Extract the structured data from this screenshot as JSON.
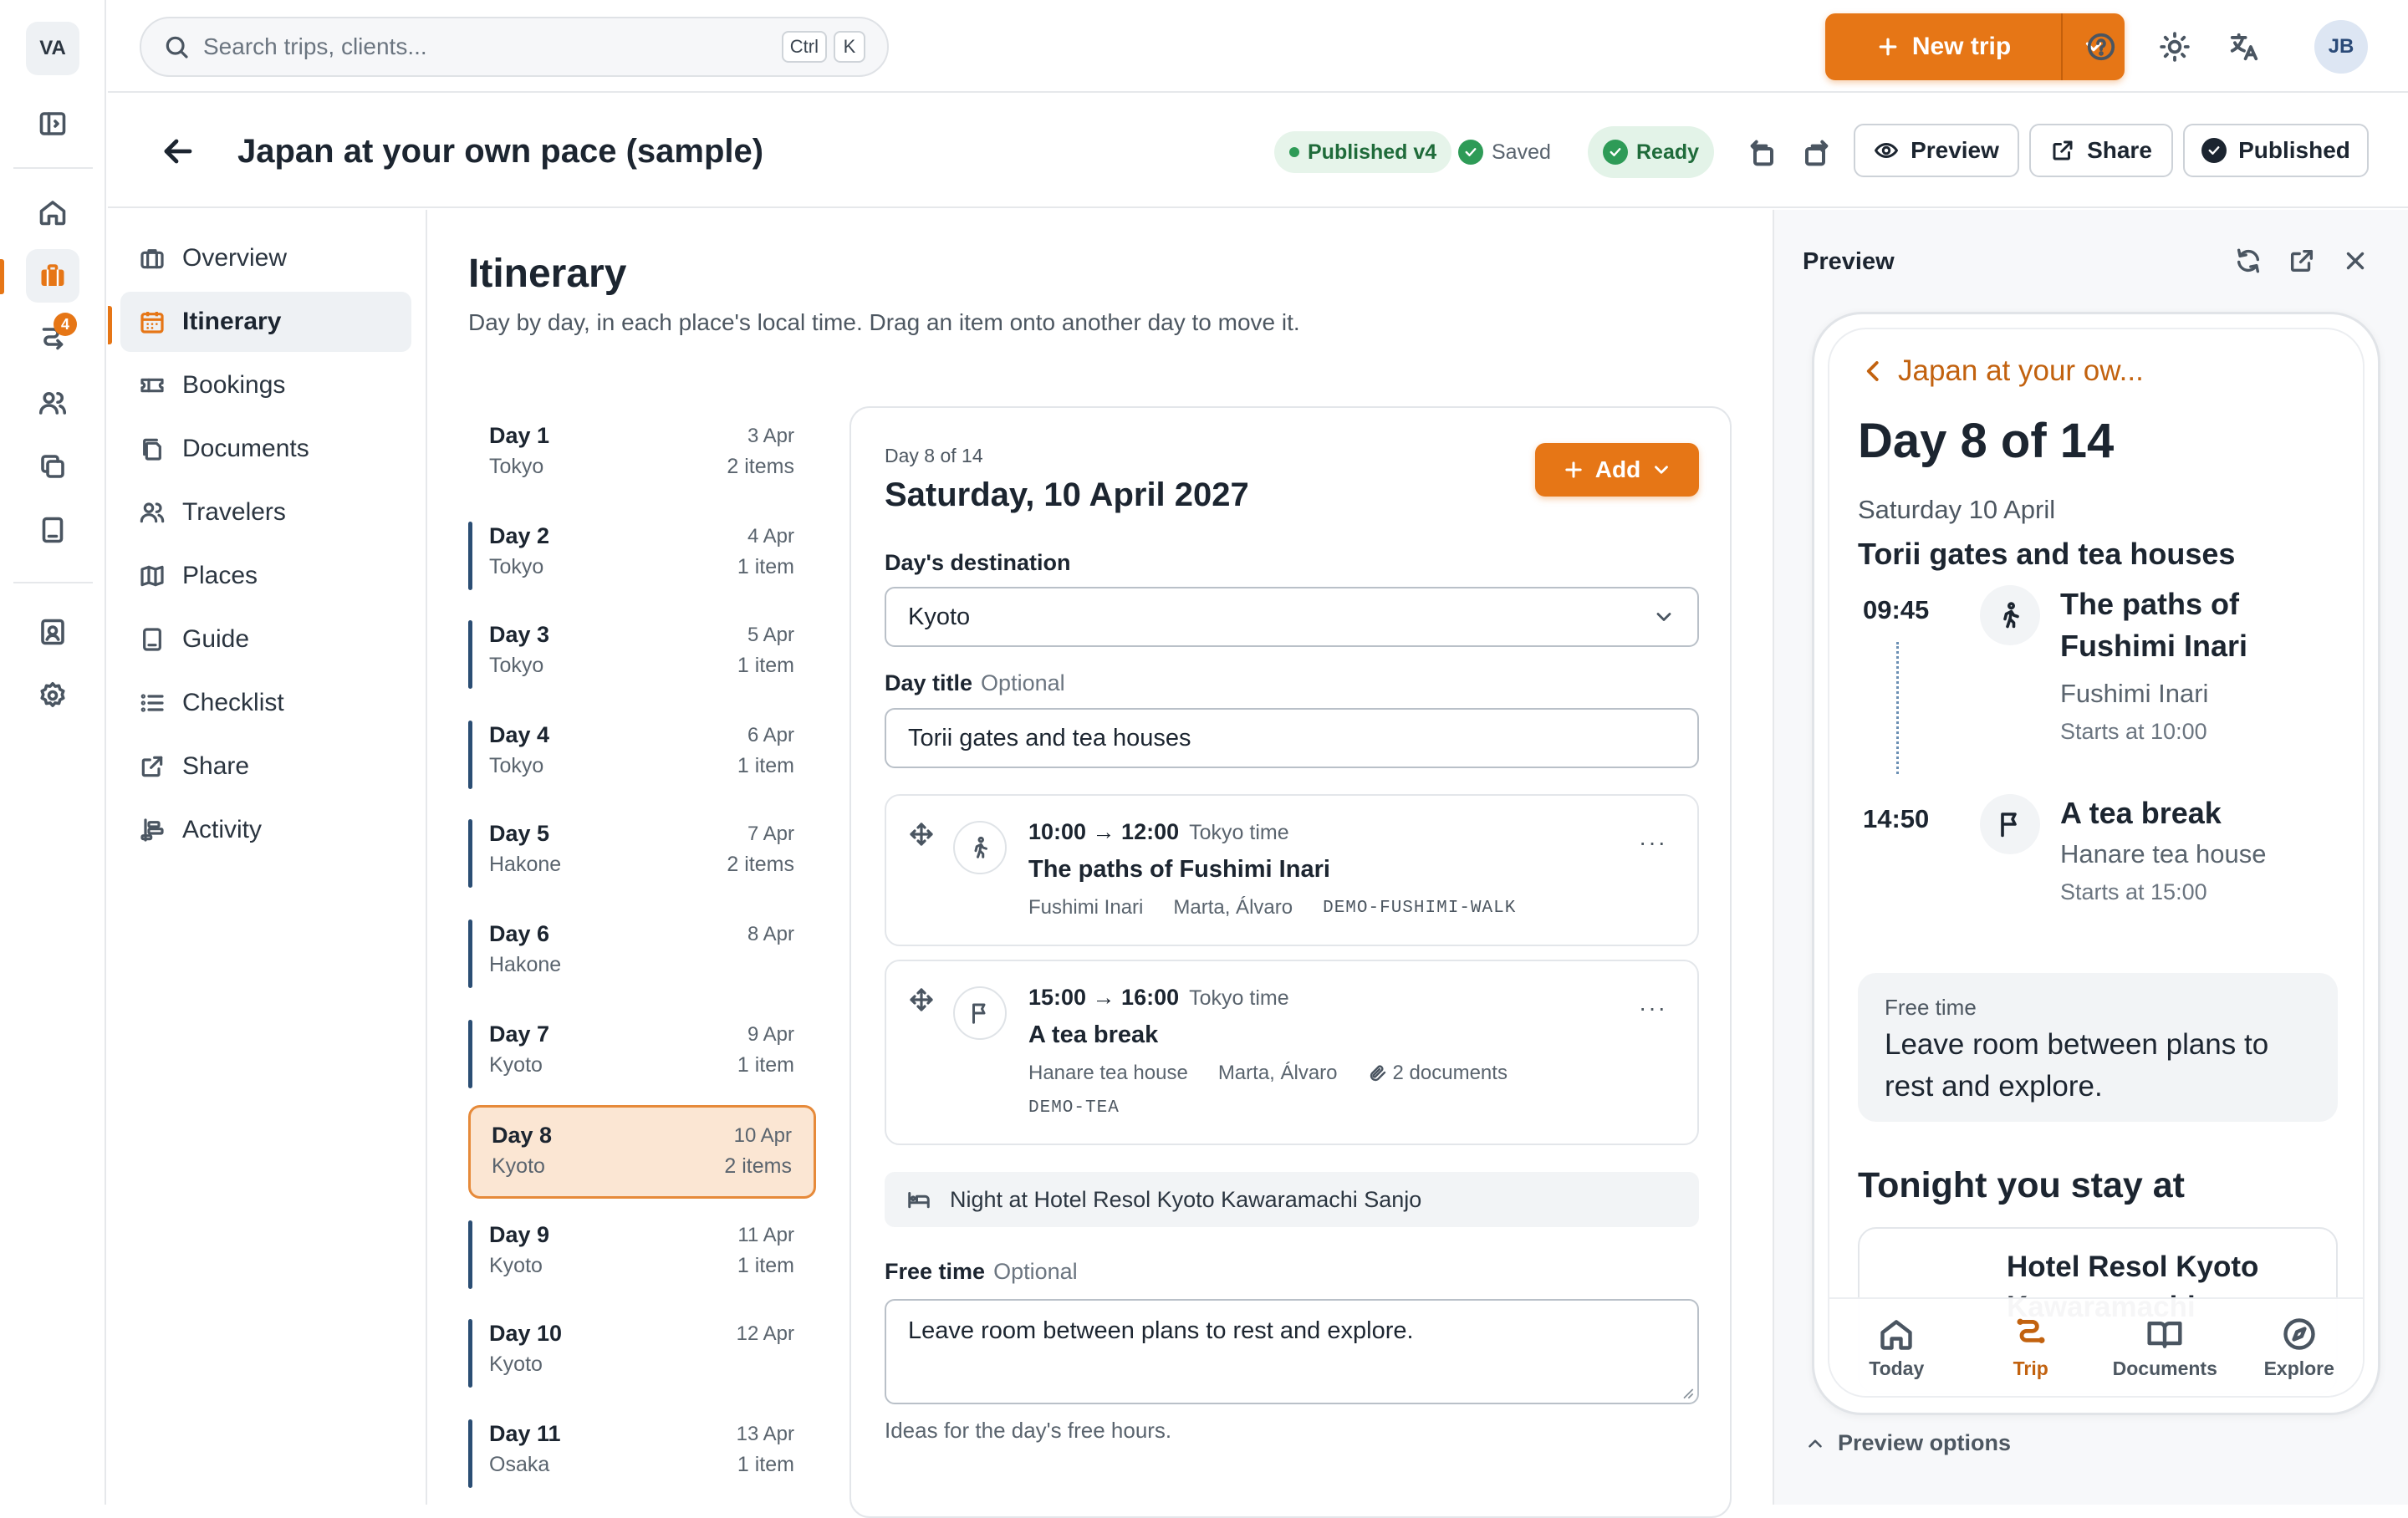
{
  "rail": {
    "workspace": "VA",
    "badge": "4"
  },
  "search": {
    "placeholder": "Search trips, clients...",
    "kbd_ctrl": "Ctrl",
    "kbd_k": "K"
  },
  "topbar": {
    "new_trip": "New trip",
    "avatar": "JB"
  },
  "trip": {
    "title": "Japan at your own pace (sample)",
    "published_badge": "Published v4",
    "saved": "Saved",
    "ready": "Ready",
    "preview_btn": "Preview",
    "share_btn": "Share",
    "published_btn": "Published"
  },
  "sidenav": {
    "items": [
      "Overview",
      "Itinerary",
      "Bookings",
      "Documents",
      "Travelers",
      "Places",
      "Guide",
      "Checklist",
      "Share",
      "Activity"
    ]
  },
  "itinerary": {
    "heading": "Itinerary",
    "subtitle": "Day by day, in each place's local time. Drag an item onto another day to move it.",
    "days": [
      {
        "name": "Day 1",
        "city": "Tokyo",
        "date": "3 Apr",
        "count": "2 items"
      },
      {
        "name": "Day 2",
        "city": "Tokyo",
        "date": "4 Apr",
        "count": "1 item"
      },
      {
        "name": "Day 3",
        "city": "Tokyo",
        "date": "5 Apr",
        "count": "1 item"
      },
      {
        "name": "Day 4",
        "city": "Tokyo",
        "date": "6 Apr",
        "count": "1 item"
      },
      {
        "name": "Day 5",
        "city": "Hakone",
        "date": "7 Apr",
        "count": "2 items"
      },
      {
        "name": "Day 6",
        "city": "Hakone",
        "date": "8 Apr",
        "count": ""
      },
      {
        "name": "Day 7",
        "city": "Kyoto",
        "date": "9 Apr",
        "count": "1 item"
      },
      {
        "name": "Day 8",
        "city": "Kyoto",
        "date": "10 Apr",
        "count": "2 items"
      },
      {
        "name": "Day 9",
        "city": "Kyoto",
        "date": "11 Apr",
        "count": "1 item"
      },
      {
        "name": "Day 10",
        "city": "Kyoto",
        "date": "12 Apr",
        "count": ""
      },
      {
        "name": "Day 11",
        "city": "Osaka",
        "date": "13 Apr",
        "count": "1 item"
      }
    ]
  },
  "day_panel": {
    "kicker": "Day 8 of 14",
    "date": "Saturday, 10 April 2027",
    "add": "Add",
    "destination_label": "Day's destination",
    "destination_value": "Kyoto",
    "title_label": "Day title",
    "optional": "Optional",
    "title_value": "Torii gates and tea houses",
    "items": [
      {
        "time": "10:00 → 12:00",
        "tz": "Tokyo time",
        "name": "The paths of Fushimi Inari",
        "place": "Fushimi Inari",
        "travelers": "Marta, Álvaro",
        "docs": "",
        "code": "DEMO-FUSHIMI-WALK",
        "icon": "walk-icon"
      },
      {
        "time": "15:00 → 16:00",
        "tz": "Tokyo time",
        "name": "A tea break",
        "place": "Hanare tea house",
        "travelers": "Marta, Álvaro",
        "docs": "2 documents",
        "code": "DEMO-TEA",
        "icon": "flag-icon"
      }
    ],
    "night": "Night at Hotel Resol Kyoto Kawaramachi Sanjo",
    "free_label": "Free time",
    "free_value": "Leave room between plans to rest and explore.",
    "free_help": "Ideas for the day's free hours."
  },
  "preview": {
    "title": "Preview",
    "back": "Japan at your ow...",
    "day": "Day 8 of 14",
    "date": "Saturday 10 April",
    "day_title": "Torii gates and tea houses",
    "items": [
      {
        "time": "09:45",
        "name": "The paths of Fushimi Inari",
        "place": "Fushimi Inari",
        "start": "Starts at 10:00"
      },
      {
        "time": "14:50",
        "name": "A tea break",
        "place": "Hanare tea house",
        "start": "Starts at 15:00"
      }
    ],
    "free_label": "Free time",
    "free_value": "Leave room between plans to rest and explore.",
    "tonight": "Tonight you stay at",
    "hotel": "Hotel Resol Kyoto Kawaramachi",
    "tabs": [
      "Today",
      "Trip",
      "Documents",
      "Explore"
    ],
    "options": "Preview options"
  },
  "colors": {
    "accent": "#e67616",
    "success": "#2e9b57",
    "selected_day": "#fbe6d3"
  }
}
